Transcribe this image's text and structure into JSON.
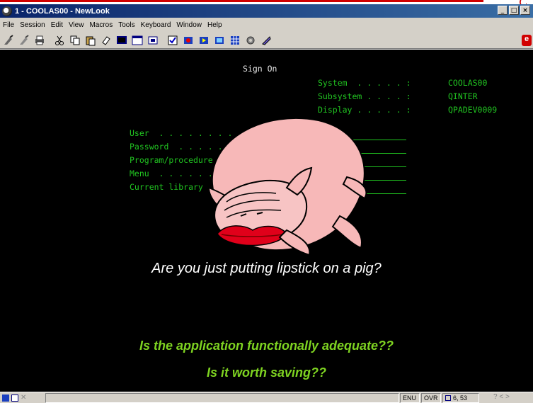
{
  "window": {
    "title": "1 - COOLAS00 - NewLook",
    "buttons": [
      "_",
      "□",
      "×"
    ]
  },
  "menu": [
    "File",
    "Session",
    "Edit",
    "View",
    "Macros",
    "Tools",
    "Keyboard",
    "Window",
    "Help"
  ],
  "toolbar": {
    "icons": [
      "connect-icon",
      "disconnect-icon",
      "print-icon",
      "cut-icon",
      "copy-icon",
      "paste-icon",
      "erase-icon",
      "screen-icon",
      "window-icon",
      "restore-icon",
      "macro-icon",
      "record-icon",
      "play-icon",
      "keypad-icon",
      "grid-icon",
      "settings-icon",
      "help-icon"
    ]
  },
  "screen": {
    "heading": "Sign On",
    "info": [
      {
        "label": "System  . . . . . :",
        "value": "COOLAS00"
      },
      {
        "label": "Subsystem . . . . :",
        "value": "QINTER"
      },
      {
        "label": "Display . . . . . :",
        "value": "QPADEV0009"
      }
    ],
    "fields": [
      {
        "label": "User  . . . . . . . . . . . . . ."
      },
      {
        "label": "Password  . . . . . . . . . . . ."
      },
      {
        "label": "Program/procedure . . . . . . . ."
      },
      {
        "label": "Menu  . . . . . . . . . . . . . ."
      },
      {
        "label": "Current library . . . . . . . . ."
      }
    ]
  },
  "captions": {
    "question": "Are you just putting lipstick on a pig?",
    "adequate": "Is the application functionally adequate??",
    "saving": "Is it worth saving??"
  },
  "status": {
    "lang": "ENU",
    "mode": "OVR",
    "position": "6, 53",
    "nav": "?  <  >"
  },
  "colors": {
    "terminal_bg": "#000000",
    "terminal_green": "#21c421",
    "caption_green": "#7ed321",
    "lipstick": "#e0001a",
    "pig": "#f7b8b8"
  }
}
